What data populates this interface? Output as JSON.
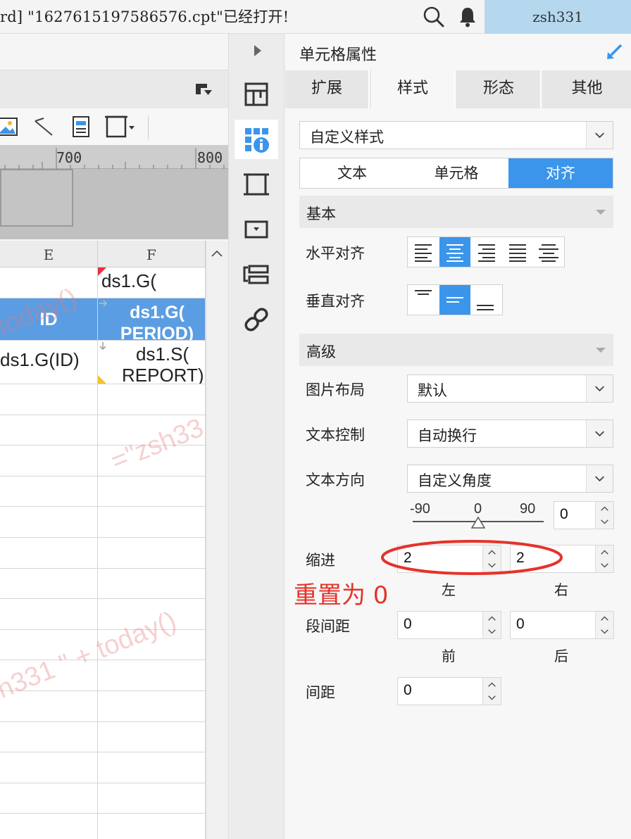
{
  "topbar": {
    "title": "rd] \"1627615197586576.cpt\"已经打开!",
    "user": "zsh331",
    "icons": [
      "search-icon",
      "bell-icon"
    ]
  },
  "editor": {
    "ruler_labels": [
      "700",
      "800"
    ],
    "toolbar_icons": [
      "image-icon",
      "line-icon",
      "form-icon",
      "border-icon"
    ],
    "columns": [
      "E",
      "F"
    ],
    "cells": {
      "f1": "ds1.G(",
      "e2": "ID",
      "f2a": "ds1.G(",
      "f2b": "PERIOD)",
      "e3": "ds1.G(ID)",
      "f3a": "ds1.S(",
      "f3b": "REPORT)"
    },
    "watermarks": [
      "today()",
      "=\"zsh33",
      "h331 \" + today()"
    ]
  },
  "side_icons": [
    "cell-element-icon",
    "cell-attribute-icon",
    "float-element-icon",
    "widget-icon",
    "condition-icon",
    "hyperlink-icon"
  ],
  "panel": {
    "title": "单元格属性",
    "tabs": [
      "扩展",
      "样式",
      "形态",
      "其他"
    ],
    "active_tab": "样式",
    "style_select": "自定义样式",
    "sub_tabs": [
      "文本",
      "单元格",
      "对齐"
    ],
    "active_sub_tab": "对齐",
    "basic": {
      "header": "基本",
      "h_align_label": "水平对齐",
      "v_align_label": "垂直对齐"
    },
    "advanced": {
      "header": "高级",
      "image_layout_label": "图片布局",
      "image_layout_value": "默认",
      "text_control_label": "文本控制",
      "text_control_value": "自动换行",
      "text_direction_label": "文本方向",
      "text_direction_value": "自定义角度",
      "angle_ticks": [
        "-90",
        "0",
        "90"
      ],
      "angle_value": "0",
      "angle_slider_fraction": 0.5,
      "indent_label": "缩进",
      "indent_left": "2",
      "indent_right": "2",
      "left_label": "左",
      "right_label": "右",
      "para_label": "段间距",
      "para_before": "0",
      "para_after": "0",
      "before_label": "前",
      "after_label": "后",
      "spacing_label": "间距",
      "spacing_value": "0"
    },
    "annotation": "重置为 0",
    "colors": {
      "accent": "#3b95ea",
      "annotation": "#e5332a",
      "user_bg": "#b5d8ef"
    }
  }
}
